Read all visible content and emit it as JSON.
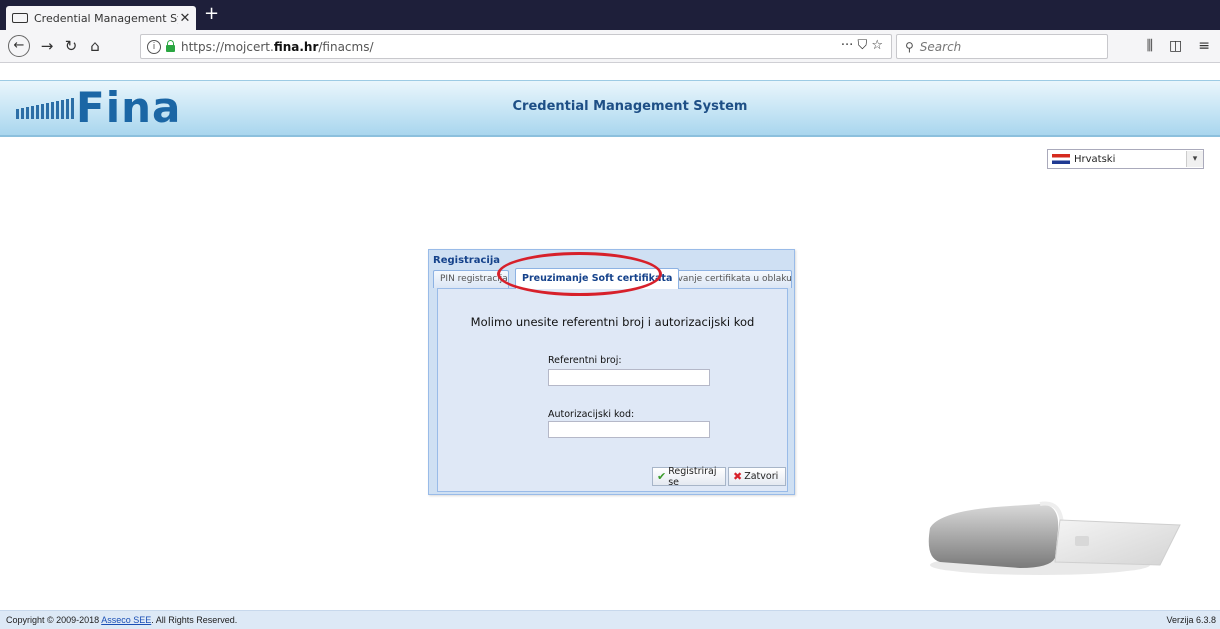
{
  "browser": {
    "tab_title": "Credential Management System",
    "new_tab": "+",
    "url_prefix": "https://mojcert.",
    "url_domain": "fina.hr",
    "url_suffix": "/finacms/",
    "search_placeholder": "Search",
    "url_actions": "··· ⛉ ☆"
  },
  "header": {
    "logo": "Fina",
    "app_title": "Credential Management System"
  },
  "language": {
    "selected": "Hrvatski"
  },
  "dialog": {
    "title": "Registracija",
    "tabs": [
      {
        "label": "PIN registracija"
      },
      {
        "label": "Preuzimanje Soft certifikata"
      },
      {
        "label": "Izdavanje certifikata u oblaku"
      }
    ],
    "heading": "Molimo unesite referentni broj i autorizacijski kod",
    "reference_label": "Referentni broj:",
    "reference_value": "",
    "auth_label": "Autorizacijski kod:",
    "auth_value": "",
    "register_button": "Registriraj se",
    "close_button": "Zatvori"
  },
  "footer": {
    "copyright_prefix": "Copyright © 2009-2018 ",
    "copyright_link": "Asseco SEE",
    "copyright_suffix": ". All Rights Reserved.",
    "version": "Verzija 6.3.8"
  }
}
